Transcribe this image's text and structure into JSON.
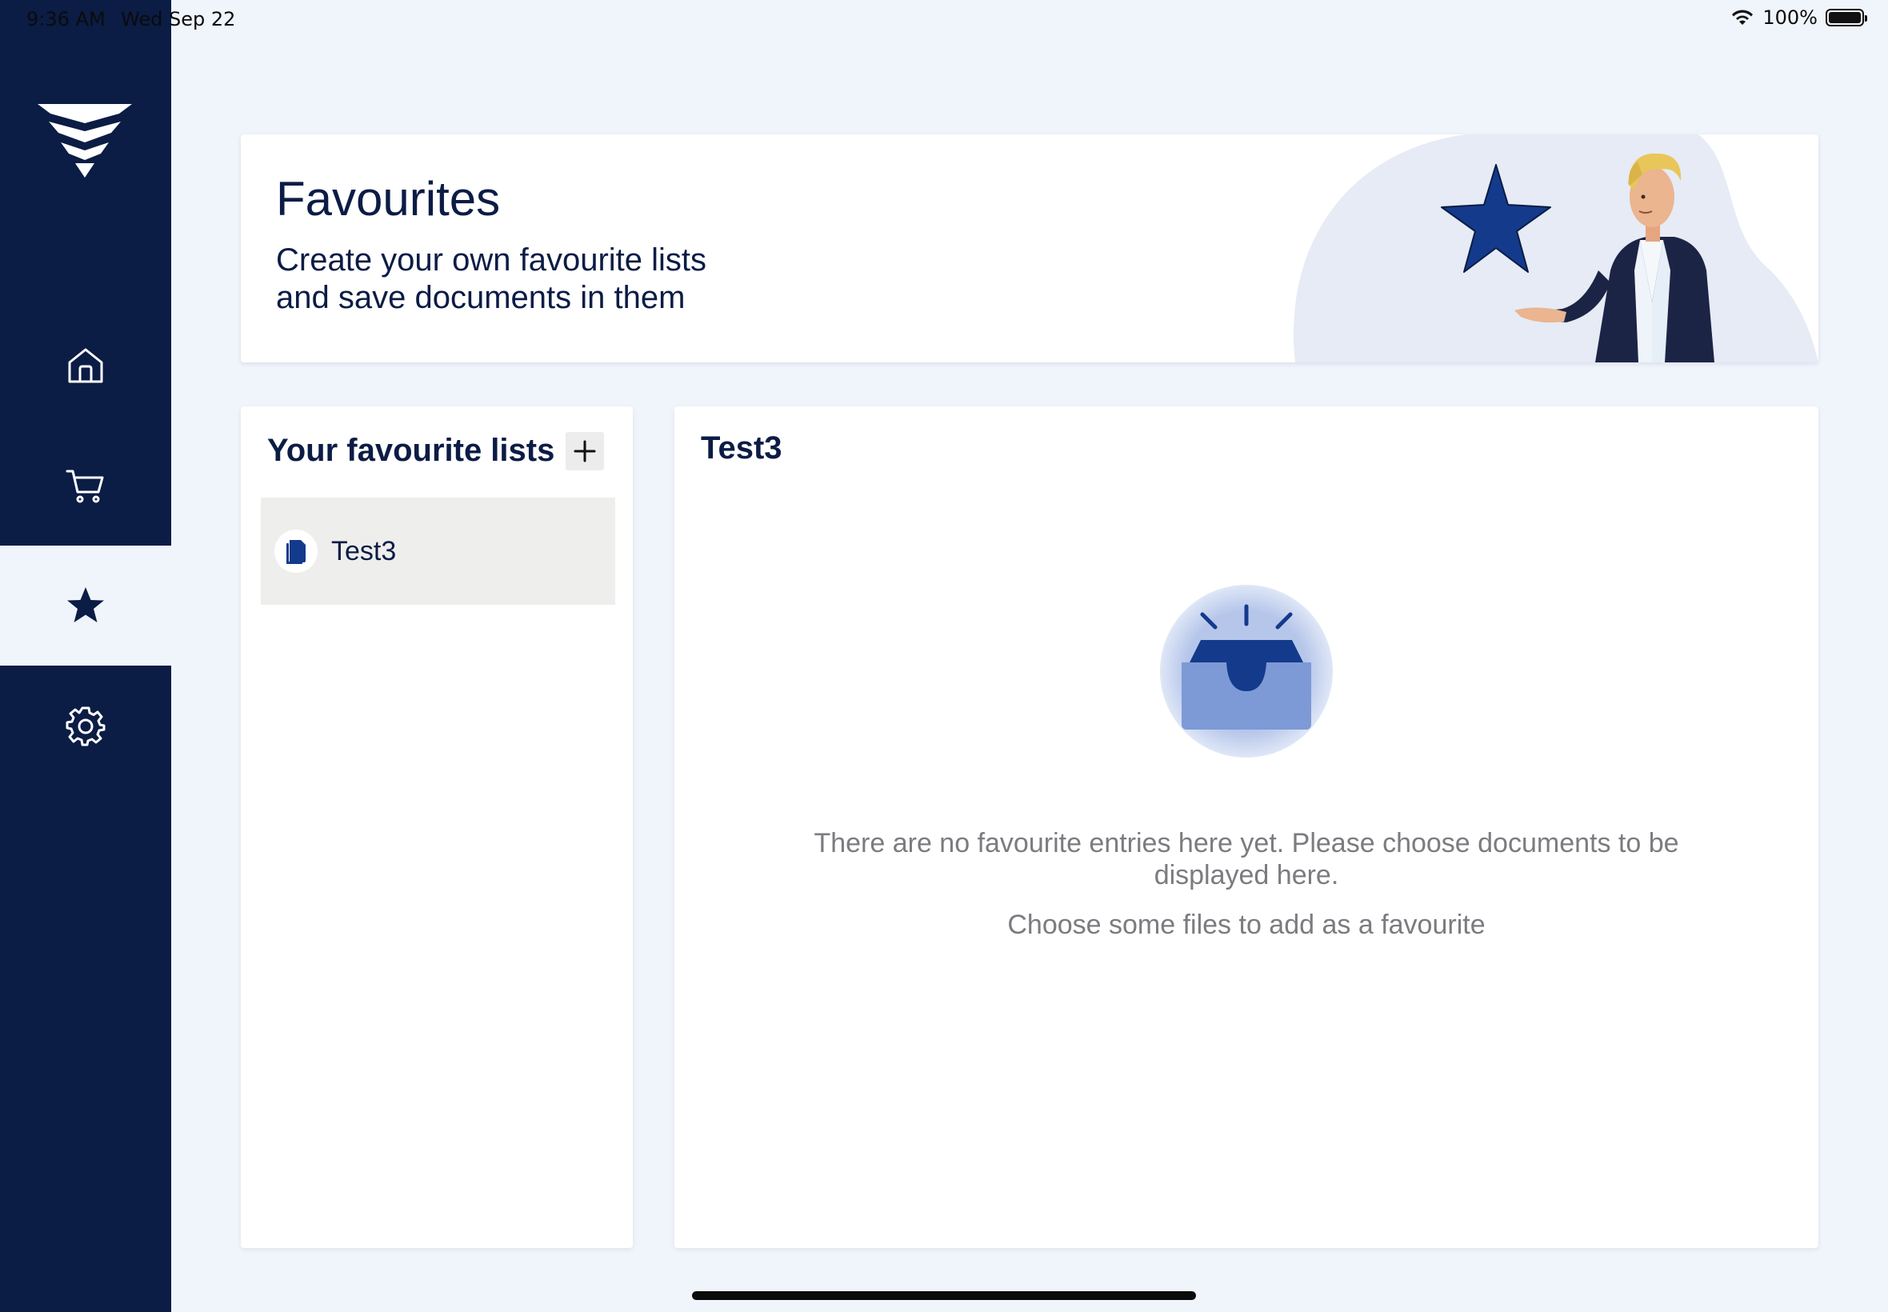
{
  "status_bar": {
    "time": "9:36 AM",
    "date": "Wed Sep 22",
    "battery": "100%",
    "icons": [
      "wifi-icon",
      "battery-icon"
    ]
  },
  "sidebar": {
    "logo": "app-logo",
    "items": [
      {
        "id": "home",
        "icon": "home-icon",
        "active": false
      },
      {
        "id": "cart",
        "icon": "cart-icon",
        "active": false
      },
      {
        "id": "favourites",
        "icon": "star-icon",
        "active": true
      },
      {
        "id": "settings",
        "icon": "gear-icon",
        "active": false
      }
    ]
  },
  "banner": {
    "title": "Favourites",
    "subtitle_line1": "Create your own favourite lists",
    "subtitle_line2": "and save documents in them"
  },
  "lists_panel": {
    "title": "Your favourite lists",
    "add_icon": "plus-icon",
    "items": [
      {
        "label": "Test3",
        "icon": "document-icon",
        "selected": true
      }
    ]
  },
  "detail_panel": {
    "title": "Test3",
    "empty_icon": "empty-inbox-icon",
    "empty_message_line1": "There are no favourite entries here yet. Please choose documents to be",
    "empty_message_line2": "displayed here.",
    "empty_hint": "Choose some files to add as a favourite"
  },
  "colors": {
    "navy": "#0b1c45",
    "background": "#f0f4fb",
    "accent_blue": "#143a8c",
    "muted_text": "#7b7b80"
  }
}
